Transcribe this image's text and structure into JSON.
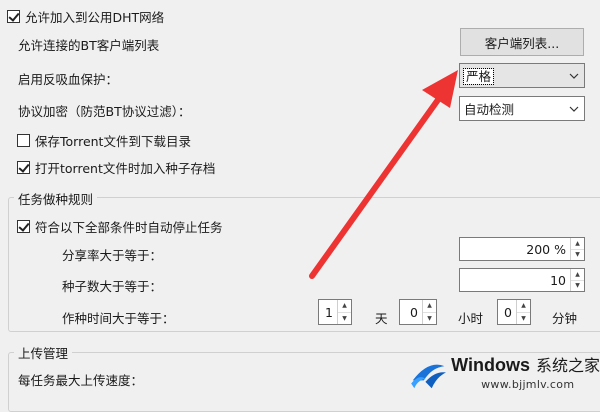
{
  "connection": {
    "dht_checkbox": {
      "label": "允许加入到公用DHT网络",
      "checked": true
    },
    "bt_clients_label": "允许连接的BT客户端列表",
    "client_list_button": "客户端列表...",
    "anti_leech_label": "启用反吸血保护：",
    "anti_leech_value": "严格",
    "encryption_label": "协议加密（防范BT协议过滤）：",
    "encryption_value": "自动检测",
    "save_torrent_checkbox": {
      "label": "保存Torrent文件到下载目录",
      "checked": false
    },
    "seed_archive_checkbox": {
      "label": "打开torrent文件时加入种子存档",
      "checked": true
    }
  },
  "seeding": {
    "group_title": "任务做种规则",
    "auto_stop_checkbox": {
      "label": "符合以下全部条件时自动停止任务",
      "checked": true
    },
    "share_ratio_label": "分享率大于等于：",
    "share_ratio_value": "200 %",
    "seed_count_label": "种子数大于等于：",
    "seed_count_value": "10",
    "seed_time_label": "作种时间大于等于：",
    "days_value": "1",
    "days_unit": "天",
    "hours_value": "0",
    "hours_unit": "小时",
    "minutes_value": "0",
    "minutes_unit": "分钟"
  },
  "upload": {
    "group_title": "上传管理",
    "per_task_label": "每任务最大上传速度："
  },
  "watermark": {
    "brand": "Windows",
    "site_name": "系统之家",
    "url": "www.bjjmlv.com"
  },
  "colors": {
    "annotation_arrow": "#ee3333",
    "window_bg": "#f0f0f0",
    "logo_blue": "#1a73d9"
  }
}
